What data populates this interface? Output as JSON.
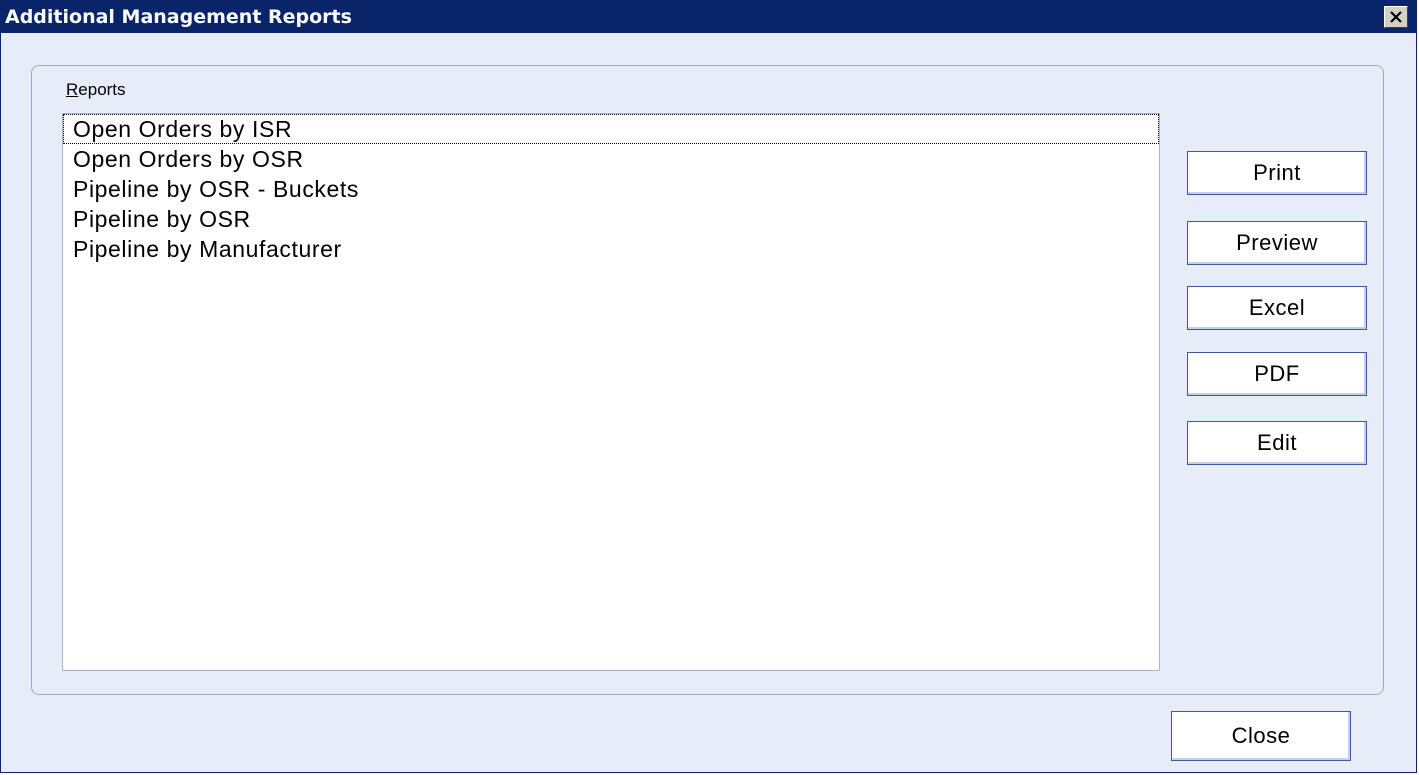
{
  "window": {
    "title": "Additional Management Reports",
    "close_icon": "close-icon"
  },
  "reports_group": {
    "label_mnemonic": "R",
    "label_rest": "eports",
    "items": [
      {
        "label": "Open Orders by ISR",
        "focused": true
      },
      {
        "label": "Open Orders by OSR",
        "focused": false
      },
      {
        "label": "Pipeline by OSR - Buckets",
        "focused": false
      },
      {
        "label": "Pipeline by OSR",
        "focused": false
      },
      {
        "label": "Pipeline by Manufacturer",
        "focused": false
      }
    ]
  },
  "actions": {
    "print_label": "Print",
    "preview_label": "Preview",
    "excel_label": "Excel",
    "pdf_label": "PDF",
    "edit_label": "Edit"
  },
  "footer": {
    "close_label": "Close"
  },
  "colors": {
    "titlebar": "#0a246a",
    "client_background": "#e6ecf8",
    "button_border": "#3a5a9a"
  }
}
